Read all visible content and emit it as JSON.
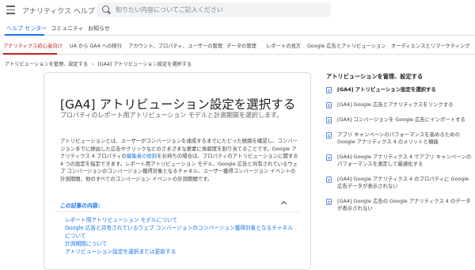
{
  "header": {
    "app_title": "アナリティクス ヘルプ",
    "search_placeholder": "知りたい内容についてご記入ください"
  },
  "tabs": [
    {
      "label": "ヘルプ センター",
      "active": true
    },
    {
      "label": "コミュニティ",
      "active": false
    },
    {
      "label": "お知らせ",
      "active": false
    }
  ],
  "category_nav": [
    {
      "label": "アナリティクス初心者向け",
      "active": true
    },
    {
      "label": "UA から GA4 への移行",
      "active": false
    },
    {
      "label": "アカウント、プロパティ、ユーザーの管理",
      "active": false
    },
    {
      "label": "データの管理",
      "active": false
    },
    {
      "label": "レポートの見方",
      "active": false
    },
    {
      "label": "Google 広告とアトリビューション",
      "active": false
    },
    {
      "label": "オーディエンスとリマーケティング",
      "active": false
    }
  ],
  "breadcrumb": {
    "parent": "アトリビューションを管理、設定する",
    "separator": "›",
    "current": "[GA4] アトリビューション設定を選択する"
  },
  "article": {
    "title": "[GA4] アトリビューション設定を選択する",
    "subtitle": "プロパティのレポート用アトリビューション モデルと計測期間を選択します。",
    "body_before_link": "アトリビューションとは、ユーザーがコンバージョンを達成するまでにたどった経路を確認し、コンバージョンまでに経由した広告やクリックなどのさまざまな要素に貢献度を割り当てることです。Google アナリティクス 4 プロパティの",
    "body_link": "編集者の役割",
    "body_after_link": "をお持ちの場合は、プロパティのアトリビューションに関する 4 つの設定を指定できます。レポート用アトリビューション モデル、Google 広告と共有されているウェブ コンバージョンのコンバージョン獲得対象となるチャネル、ユーザー獲得コンバージョン イベントの計測期間、他のすべてのコンバージョン イベントの計測期間です。",
    "toc_heading": "この記事の内容:",
    "toc_items": [
      "レポート用アトリビューション モデルについて",
      "Google 広告と共有されているウェブ コンバージョンのコンバージョン獲得対象となるチャネルについて",
      "計測期間について",
      "アトリビューション設定を選択または更新する"
    ]
  },
  "sidebar": {
    "title": "アトリビューションを管理、設定する",
    "items": [
      {
        "label": "[GA4] アトリビューション設定を選択する",
        "current": true
      },
      {
        "label": "[GA4] Google 広告とアナリティクスをリンクする",
        "current": false
      },
      {
        "label": "[GA4] コンバージョンを Google 広告にインポートする",
        "current": false
      },
      {
        "label": "アプリ キャンペーンのパフォーマンスを高めるための Google アナリティクス 4 のメリットと機能",
        "current": false
      },
      {
        "label": "[GA4] Google アナリティクス 4 でアプリ キャンペーンのパフォーマンスを測定して最適化する",
        "current": false
      },
      {
        "label": "[GA4] Google アナリティクス 4 のプロパティに Google 広告データが表示されない",
        "current": false
      },
      {
        "label": "[GA4] Google 広告の Google アナリティクス 4 のデータが表示されない",
        "current": false
      }
    ]
  }
}
